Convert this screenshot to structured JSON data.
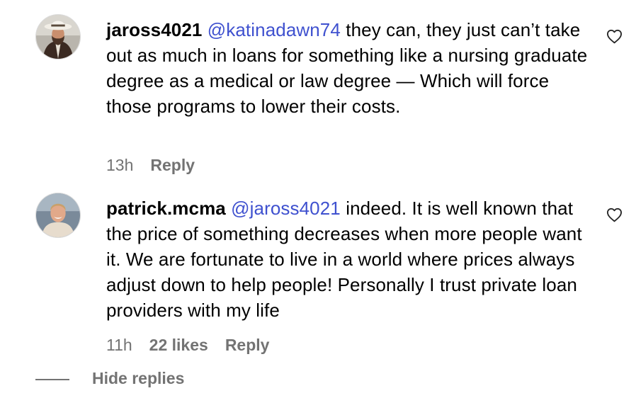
{
  "comments": [
    {
      "username": "jaross4021",
      "mention": "@katinadawn74",
      "text": " they can, they just can’t take out as much in loans for something like a nursing graduate degree as a medical or law degree — Which will force those programs to lower their costs.",
      "time": "13h",
      "likes": "",
      "reply_label": "Reply",
      "avatar_icon": "cowboy-hat-avatar",
      "like_icon": "heart-outline-icon"
    },
    {
      "username": "patrick.mcma",
      "mention": "@jaross4021",
      "text": " indeed. It is well known that the price of something decreases when more people want it. We are fortunate to live in a world where prices always adjust down to help people! Personally I trust private loan providers with my life",
      "time": "11h",
      "likes": "22 likes",
      "reply_label": "Reply",
      "avatar_icon": "smiling-man-avatar",
      "like_icon": "heart-outline-icon"
    }
  ],
  "hide_replies_label": "Hide replies",
  "colors": {
    "mention": "#3f51cf",
    "meta_text": "#737373",
    "body_text": "#000000"
  }
}
